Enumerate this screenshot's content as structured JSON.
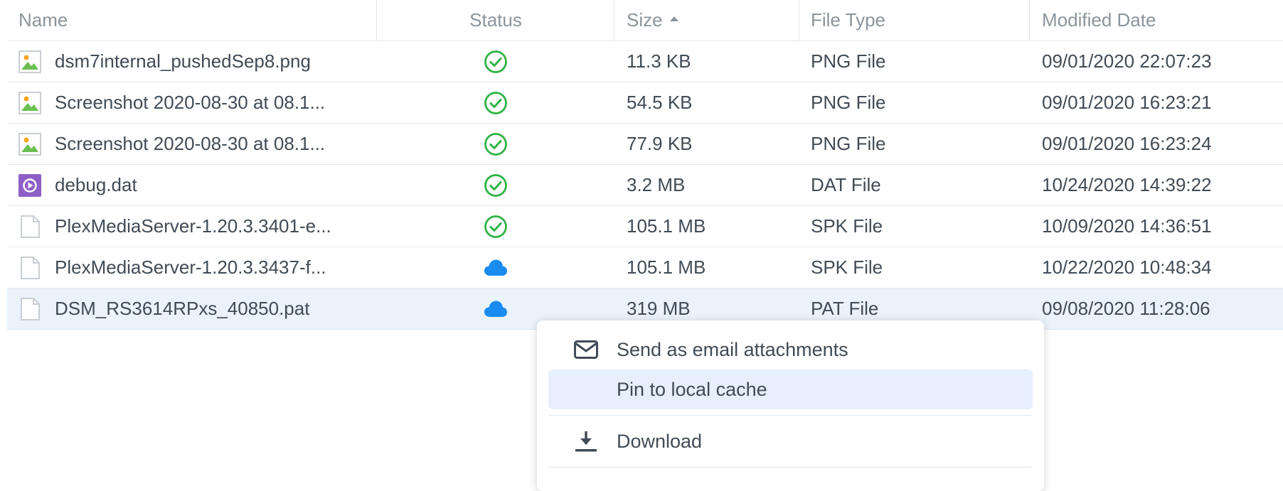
{
  "columns": {
    "name": "Name",
    "status": "Status",
    "size": "Size",
    "file_type": "File Type",
    "modified": "Modified Date"
  },
  "sort": {
    "column": "Size",
    "direction": "ascending"
  },
  "rows": [
    {
      "name": "dsm7internal_pushedSep8.png",
      "icon": "image-icon",
      "status": "synced",
      "size": "11.3 KB",
      "type": "PNG File",
      "modified": "09/01/2020 22:07:23"
    },
    {
      "name": "Screenshot 2020-08-30 at 08.1...",
      "icon": "image-icon",
      "status": "synced",
      "size": "54.5 KB",
      "type": "PNG File",
      "modified": "09/01/2020 16:23:21"
    },
    {
      "name": "Screenshot 2020-08-30 at 08.1...",
      "icon": "image-icon",
      "status": "synced",
      "size": "77.9 KB",
      "type": "PNG File",
      "modified": "09/01/2020 16:23:24"
    },
    {
      "name": "debug.dat",
      "icon": "media-file-icon",
      "status": "synced",
      "size": "3.2 MB",
      "type": "DAT File",
      "modified": "10/24/2020 14:39:22"
    },
    {
      "name": "PlexMediaServer-1.20.3.3401-e...",
      "icon": "document-icon",
      "status": "synced",
      "size": "105.1 MB",
      "type": "SPK File",
      "modified": "10/09/2020 14:36:51"
    },
    {
      "name": "PlexMediaServer-1.20.3.3437-f...",
      "icon": "document-icon",
      "status": "cloud",
      "size": "105.1 MB",
      "type": "SPK File",
      "modified": "10/22/2020 10:48:34"
    },
    {
      "name": "DSM_RS3614RPxs_40850.pat",
      "icon": "document-icon",
      "status": "cloud",
      "size": "319 MB",
      "type": "PAT File",
      "modified": "09/08/2020 11:28:06",
      "selected": true
    }
  ],
  "context_menu": {
    "send_email": "Send as email attachments",
    "pin_cache": "Pin to local cache",
    "download": "Download"
  },
  "colors": {
    "synced": "#2fb344",
    "cloud": "#1a8cf0",
    "selected_row": "#eaf2fc",
    "menu_hover": "#e6effb"
  }
}
